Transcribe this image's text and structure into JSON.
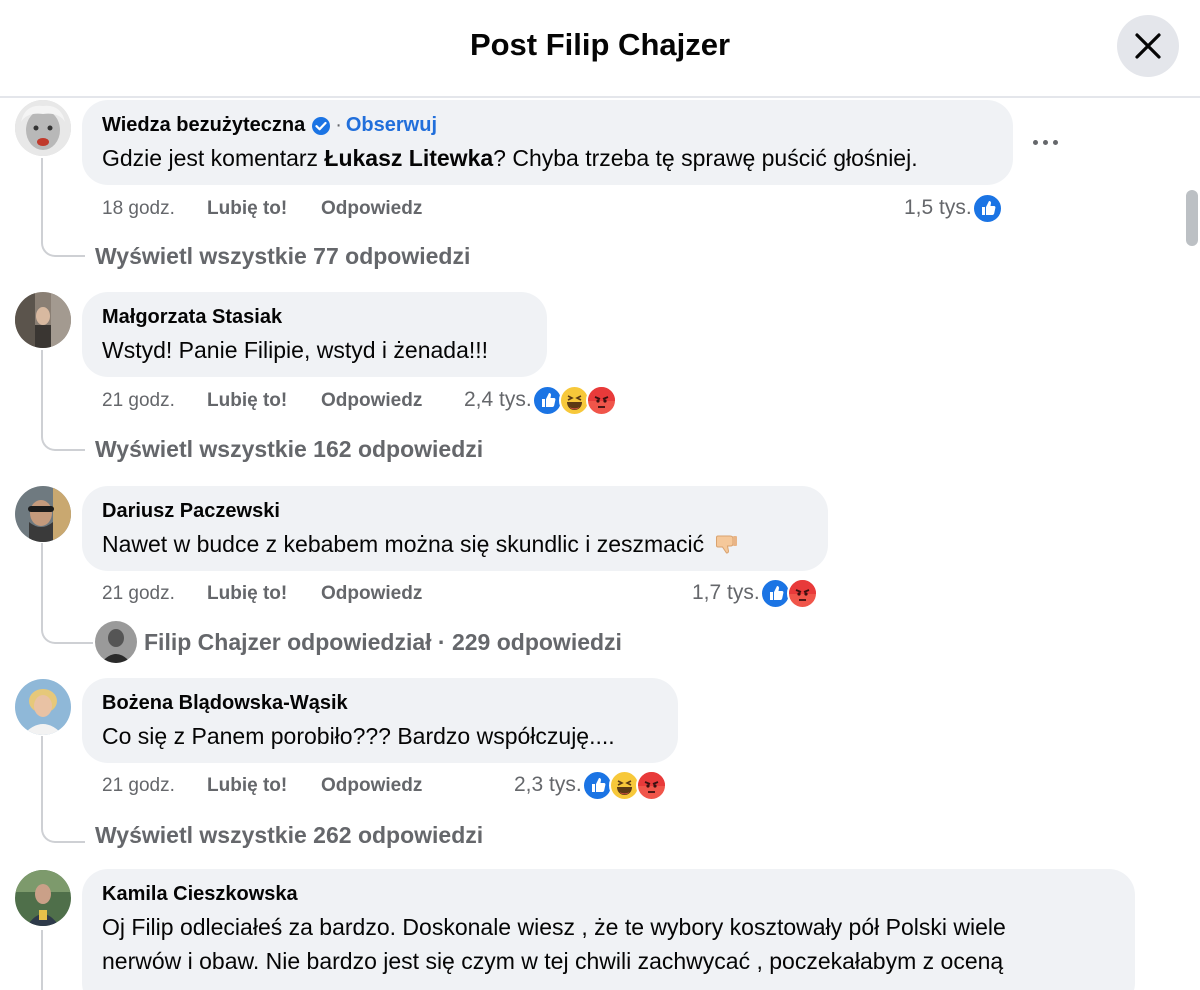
{
  "header": {
    "title": "Post Filip Chajzer"
  },
  "comments": [
    {
      "author": "Wiedza bezużyteczna",
      "follow_label": "Obserwuj",
      "text_before": "Gdzie jest komentarz ",
      "text_tag": "Łukasz Litewka",
      "text_after": "? Chyba trzeba tę sprawę puścić głośniej.",
      "time": "18 godz.",
      "like_label": "Lubię to!",
      "reply_label": "Odpowiedz",
      "reaction_count": "1,5 tys.",
      "reactions": [
        "like-icon"
      ],
      "view_replies": "Wyświetl wszystkie 77 odpowiedzi"
    },
    {
      "author": "Małgorzata Stasiak",
      "text": "Wstyd! Panie Filipie, wstyd i żenada!!!",
      "time": "21 godz.",
      "like_label": "Lubię to!",
      "reply_label": "Odpowiedz",
      "reaction_count": "2,4 tys.",
      "reactions": [
        "like-icon",
        "haha-icon",
        "angry-icon"
      ],
      "view_replies": "Wyświetl wszystkie 162 odpowiedzi"
    },
    {
      "author": "Dariusz Paczewski",
      "text": "Nawet w budce z kebabem można się skundlic i zeszmacić",
      "emoji": "thumbs-down-emoji",
      "time": "21 godz.",
      "like_label": "Lubię to!",
      "reply_label": "Odpowiedz",
      "reaction_count": "1,7 tys.",
      "reactions": [
        "like-icon",
        "angry-icon"
      ],
      "view_replies": "Filip Chajzer odpowiedział · 229 odpowiedzi"
    },
    {
      "author": "Bożena Blądowska-Wąsik",
      "text": "Co się z Panem porobiło??? Bardzo współczuję....",
      "time": "21 godz.",
      "like_label": "Lubię to!",
      "reply_label": "Odpowiedz",
      "reaction_count": "2,3 tys.",
      "reactions": [
        "like-icon",
        "haha-icon",
        "angry-icon"
      ],
      "view_replies": "Wyświetl wszystkie 262 odpowiedzi"
    },
    {
      "author": "Kamila Cieszkowska",
      "text_line1": "Oj Filip odleciałeś za bardzo. Doskonale wiesz , że te wybory kosztowały pół Polski wiele",
      "text_line2": "nerwów i obaw. Nie bardzo jest się czym w tej chwili zachwycać , poczekałabym z oceną"
    }
  ]
}
